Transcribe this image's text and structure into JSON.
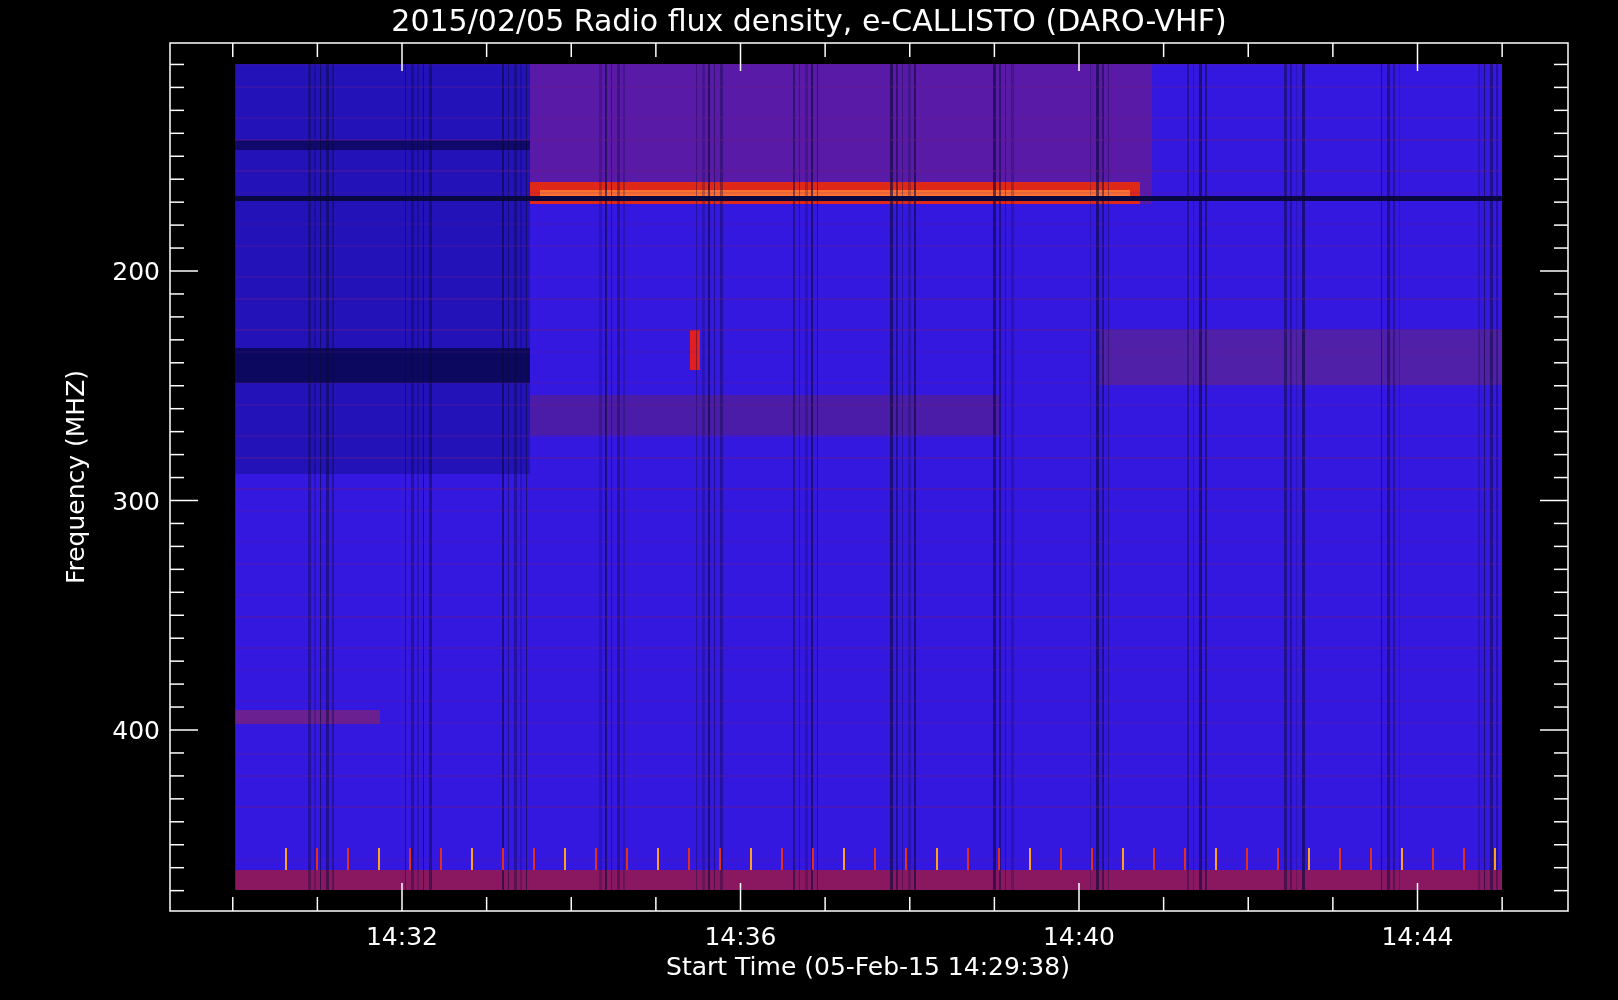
{
  "title": "2015/02/05  Radio flux density, e-CALLISTO (DARO-VHF)",
  "y_axis": {
    "label": "Frequency (MHZ)",
    "ticks": [
      "200",
      "300",
      "400"
    ]
  },
  "x_axis": {
    "label": "Start Time (05-Feb-15 14:29:38)",
    "ticks": [
      "14:32",
      "14:36",
      "14:40",
      "14:44"
    ]
  }
}
